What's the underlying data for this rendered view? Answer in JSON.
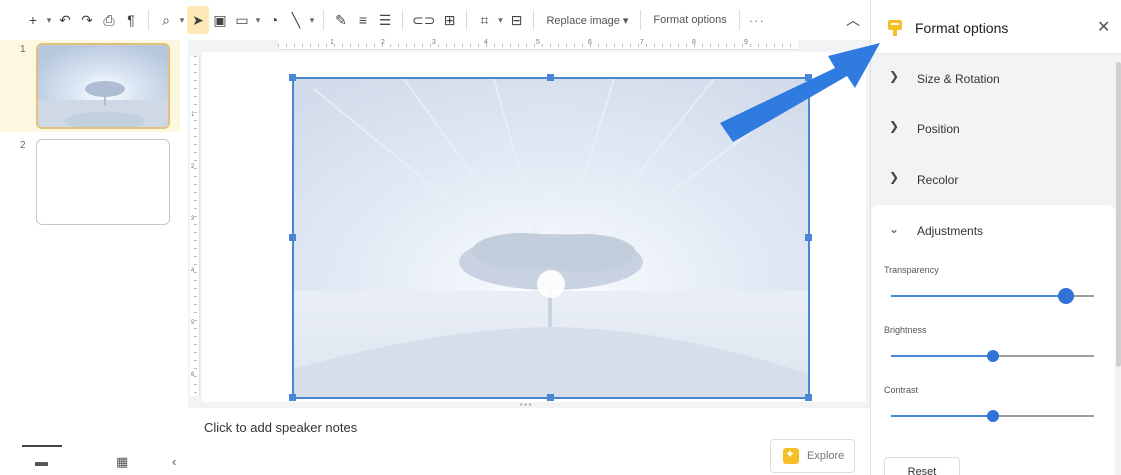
{
  "toolbar": {
    "replace_image_label": "Replace image ▾",
    "format_options_label": "Format options",
    "more_label": "···",
    "icons": [
      "plus-icon",
      "undo-icon",
      "redo-icon",
      "print-icon",
      "paint-format-icon",
      "zoom-icon",
      "select-cursor-icon",
      "text-box-icon",
      "image-icon",
      "shape-icon",
      "line-icon",
      "pen-icon",
      "line-weight-icon",
      "line-dash-icon",
      "link-icon",
      "comment-icon",
      "crop-icon",
      "mask-icon"
    ]
  },
  "ruler": {
    "top_numbers": [
      "1",
      "2",
      "3",
      "4",
      "5",
      "6",
      "7",
      "8",
      "9"
    ],
    "left_numbers": [
      "1",
      "2",
      "3",
      "4",
      "5",
      "6"
    ]
  },
  "filmstrip": {
    "slides": [
      {
        "number": "1",
        "active": true
      },
      {
        "number": "2",
        "active": false
      }
    ]
  },
  "notes": {
    "placeholder": "Click to add speaker notes",
    "explore_label": "Explore"
  },
  "panel": {
    "title": "Format options",
    "close_label": "✕",
    "sections": [
      {
        "label": "Size & Rotation",
        "expanded": false
      },
      {
        "label": "Position",
        "expanded": false
      },
      {
        "label": "Recolor",
        "expanded": false
      }
    ],
    "adjustments": {
      "label": "Adjustments",
      "sliders": [
        {
          "label": "Transparency",
          "value_fraction": 0.86
        },
        {
          "label": "Brightness",
          "value_fraction": 0.5
        },
        {
          "label": "Contrast",
          "value_fraction": 0.5
        }
      ],
      "reset_label": "Reset"
    }
  },
  "colors": {
    "accent_blue": "#2f72d8",
    "selection_blue": "#4a86d6",
    "active_slide_bg": "#fef7e0",
    "explore_yellow": "#f6bf26"
  }
}
